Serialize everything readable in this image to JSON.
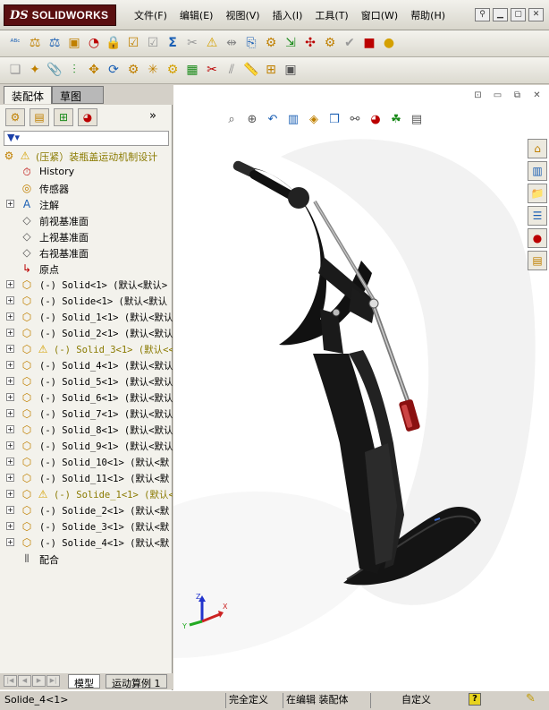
{
  "app": {
    "logo_prefix": "DS",
    "logo_text": "SOLIDWORKS"
  },
  "menu": [
    "文件(F)",
    "编辑(E)",
    "视图(V)",
    "插入(I)",
    "工具(T)",
    "窗口(W)",
    "帮助(H)"
  ],
  "tabs": {
    "active": "装配体",
    "inactive": "草图"
  },
  "tree": {
    "root": "(压紧）装瓶盖运动机制设计",
    "items": [
      {
        "label": "History",
        "icon": "history-icon",
        "mono": false
      },
      {
        "label": "传感器",
        "icon": "sensor-icon",
        "mono": false
      },
      {
        "label": "注解",
        "icon": "annotation-icon",
        "mono": false,
        "expandable": true
      },
      {
        "label": "前视基准面",
        "icon": "plane-icon",
        "mono": false
      },
      {
        "label": "上视基准面",
        "icon": "plane-icon",
        "mono": false
      },
      {
        "label": "右视基准面",
        "icon": "plane-icon",
        "mono": false
      },
      {
        "label": "原点",
        "icon": "origin-icon",
        "mono": false
      },
      {
        "label": "(-) Solid<1> (默认<默认>",
        "icon": "part-icon",
        "mono": true,
        "expandable": true
      },
      {
        "label": "(-) Solide<1> (默认<默认",
        "icon": "part-icon",
        "mono": true,
        "expandable": true
      },
      {
        "label": "(-) Solid_1<1> (默认<默认",
        "icon": "part-icon",
        "mono": true,
        "expandable": true
      },
      {
        "label": "(-) Solid_2<1> (默认<默认",
        "icon": "part-icon",
        "mono": true,
        "expandable": true
      },
      {
        "label": "(-) Solid_3<1> (默认<<",
        "icon": "part-icon",
        "mono": true,
        "expandable": true,
        "warning": true
      },
      {
        "label": "(-) Solid_4<1> (默认<默认",
        "icon": "part-icon",
        "mono": true,
        "expandable": true
      },
      {
        "label": "(-) Solid_5<1> (默认<默认",
        "icon": "part-icon",
        "mono": true,
        "expandable": true
      },
      {
        "label": "(-) Solid_6<1> (默认<默认",
        "icon": "part-icon",
        "mono": true,
        "expandable": true
      },
      {
        "label": "(-) Solid_7<1> (默认<默认",
        "icon": "part-icon",
        "mono": true,
        "expandable": true
      },
      {
        "label": "(-) Solid_8<1> (默认<默认",
        "icon": "part-icon",
        "mono": true,
        "expandable": true
      },
      {
        "label": "(-) Solid_9<1> (默认<默认",
        "icon": "part-icon",
        "mono": true,
        "expandable": true
      },
      {
        "label": "(-) Solid_10<1> (默认<默",
        "icon": "part-icon",
        "mono": true,
        "expandable": true
      },
      {
        "label": "(-) Solid_11<1> (默认<默",
        "icon": "part-icon",
        "mono": true,
        "expandable": true
      },
      {
        "label": "(-) Solide_1<1> (默认<",
        "icon": "part-icon",
        "mono": true,
        "expandable": true,
        "warning": true
      },
      {
        "label": "(-) Solide_2<1> (默认<默",
        "icon": "part-icon",
        "mono": true,
        "expandable": true
      },
      {
        "label": "(-) Solide_3<1> (默认<默",
        "icon": "part-icon",
        "mono": true,
        "expandable": true
      },
      {
        "label": "(-) Solide_4<1> (默认<默",
        "icon": "part-icon",
        "mono": true,
        "expandable": true
      },
      {
        "label": "配合",
        "icon": "mates-icon",
        "mono": false
      }
    ]
  },
  "bottom_tabs": {
    "model": "模型",
    "motion": "运动算例 1"
  },
  "triad": {
    "z": "Z",
    "x": "X",
    "y": "Y"
  },
  "status": {
    "selection": "Solide_4<1>",
    "state": "完全定义",
    "editing": "在编辑 装配体",
    "custom": "自定义",
    "help": "?"
  },
  "colors": {
    "logo_bg": "#5a0f10",
    "warning_text": "#8a7a00",
    "model_body": "#111111",
    "handle_grip": "#8a1010"
  }
}
